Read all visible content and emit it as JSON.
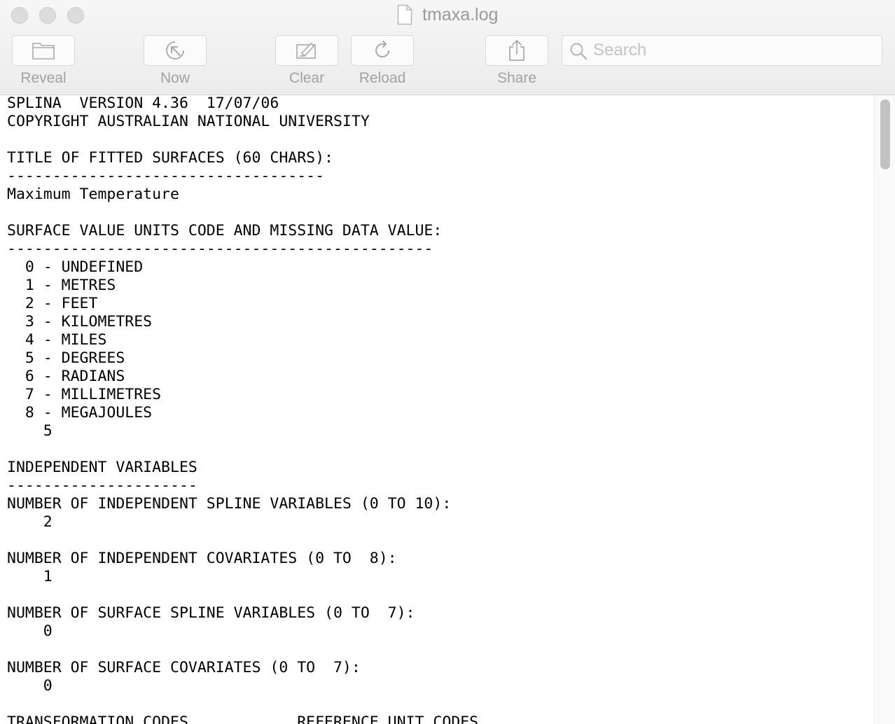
{
  "window": {
    "title": "tmaxa.log"
  },
  "toolbar": {
    "reveal_label": "Reveal",
    "now_label": "Now",
    "clear_label": "Clear",
    "reload_label": "Reload",
    "share_label": "Share",
    "search_placeholder": "Search",
    "search_value": ""
  },
  "icons": {
    "reveal": "folder-icon",
    "now": "jump-to-now-icon",
    "clear": "clear-icon",
    "reload": "reload-icon",
    "share": "share-icon",
    "search": "search-icon",
    "file": "document-icon"
  },
  "colors": {
    "toolbar_label": "#a2a2a2",
    "icon": "#a9a9a9",
    "text": "#000000"
  },
  "log": {
    "text": "SPLINA  VERSION 4.36  17/07/06\nCOPYRIGHT AUSTRALIAN NATIONAL UNIVERSITY\n\nTITLE OF FITTED SURFACES (60 CHARS):\n-----------------------------------\nMaximum Temperature\n\nSURFACE VALUE UNITS CODE AND MISSING DATA VALUE:\n-----------------------------------------------\n  0 - UNDEFINED\n  1 - METRES\n  2 - FEET\n  3 - KILOMETRES\n  4 - MILES\n  5 - DEGREES\n  6 - RADIANS\n  7 - MILLIMETRES\n  8 - MEGAJOULES\n    5\n\nINDEPENDENT VARIABLES\n---------------------\nNUMBER OF INDEPENDENT SPLINE VARIABLES (0 TO 10):\n    2\n\nNUMBER OF INDEPENDENT COVARIATES (0 TO  8):\n    1\n\nNUMBER OF SURFACE SPLINE VARIABLES (0 TO  7):\n    0\n\nNUMBER OF SURFACE COVARIATES (0 TO  7):\n    0\n\nTRANSFORMATION CODES            REFERENCE UNIT CODES"
  }
}
